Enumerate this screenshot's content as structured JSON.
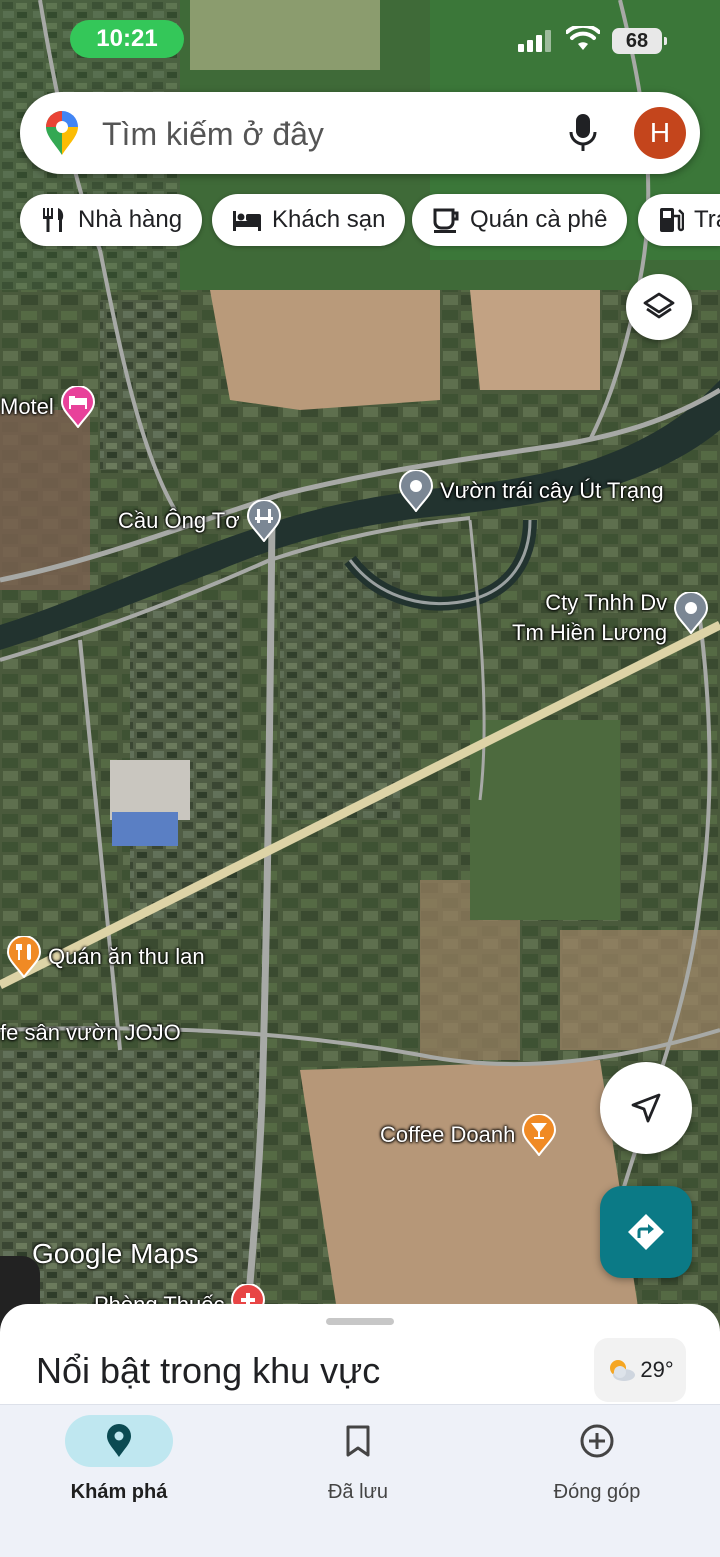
{
  "status_bar": {
    "time": "10:21",
    "battery": "68",
    "time_color": "#34c759"
  },
  "search": {
    "placeholder": "Tìm kiếm ở đây",
    "avatar_initial": "H",
    "avatar_color": "#c4451c"
  },
  "chips": [
    {
      "label": "Nhà hàng",
      "icon": "restaurant-icon"
    },
    {
      "label": "Khách sạn",
      "icon": "hotel-icon"
    },
    {
      "label": "Quán cà phê",
      "icon": "coffee-icon"
    },
    {
      "label": "Trạ",
      "icon": "gas-station-icon"
    }
  ],
  "map": {
    "places": [
      {
        "name": "Motel",
        "icon": "hotel-pin-icon",
        "color": "#e8419a"
      },
      {
        "name": "Vườn trái cây Út Trạng",
        "icon": "place-pin-icon",
        "color": "#7b8794"
      },
      {
        "name": "Cầu Ông Tơ",
        "icon": "bridge-pin-icon",
        "color": "#7b8794"
      },
      {
        "name": "Cty Tnhh Dv\nTm Hiền Lương",
        "icon": "place-pin-icon",
        "color": "#7b8794"
      },
      {
        "name": "Quán ăn thu lan",
        "icon": "restaurant-pin-icon",
        "color": "#f08a24"
      },
      {
        "name": "fe sân vườn JOJO",
        "icon": "none",
        "color": ""
      },
      {
        "name": "Coffee Doanh",
        "icon": "cafe-pin-icon",
        "color": "#f08a24"
      },
      {
        "name": "Phòng Thuốc",
        "icon": "pharmacy-pin-icon",
        "color": "#e84545"
      }
    ],
    "watermark": "Google Maps"
  },
  "sheet": {
    "title": "Nổi bật trong khu vực",
    "temperature": "29°"
  },
  "nav": [
    {
      "label": "Khám phá",
      "icon": "explore-pin-icon",
      "active": true
    },
    {
      "label": "Đã lưu",
      "icon": "bookmark-icon",
      "active": false
    },
    {
      "label": "Đóng góp",
      "icon": "add-circle-icon",
      "active": false
    }
  ],
  "colors": {
    "accent": "#0b7a86",
    "nav_active_bg": "#bfe7f0"
  }
}
